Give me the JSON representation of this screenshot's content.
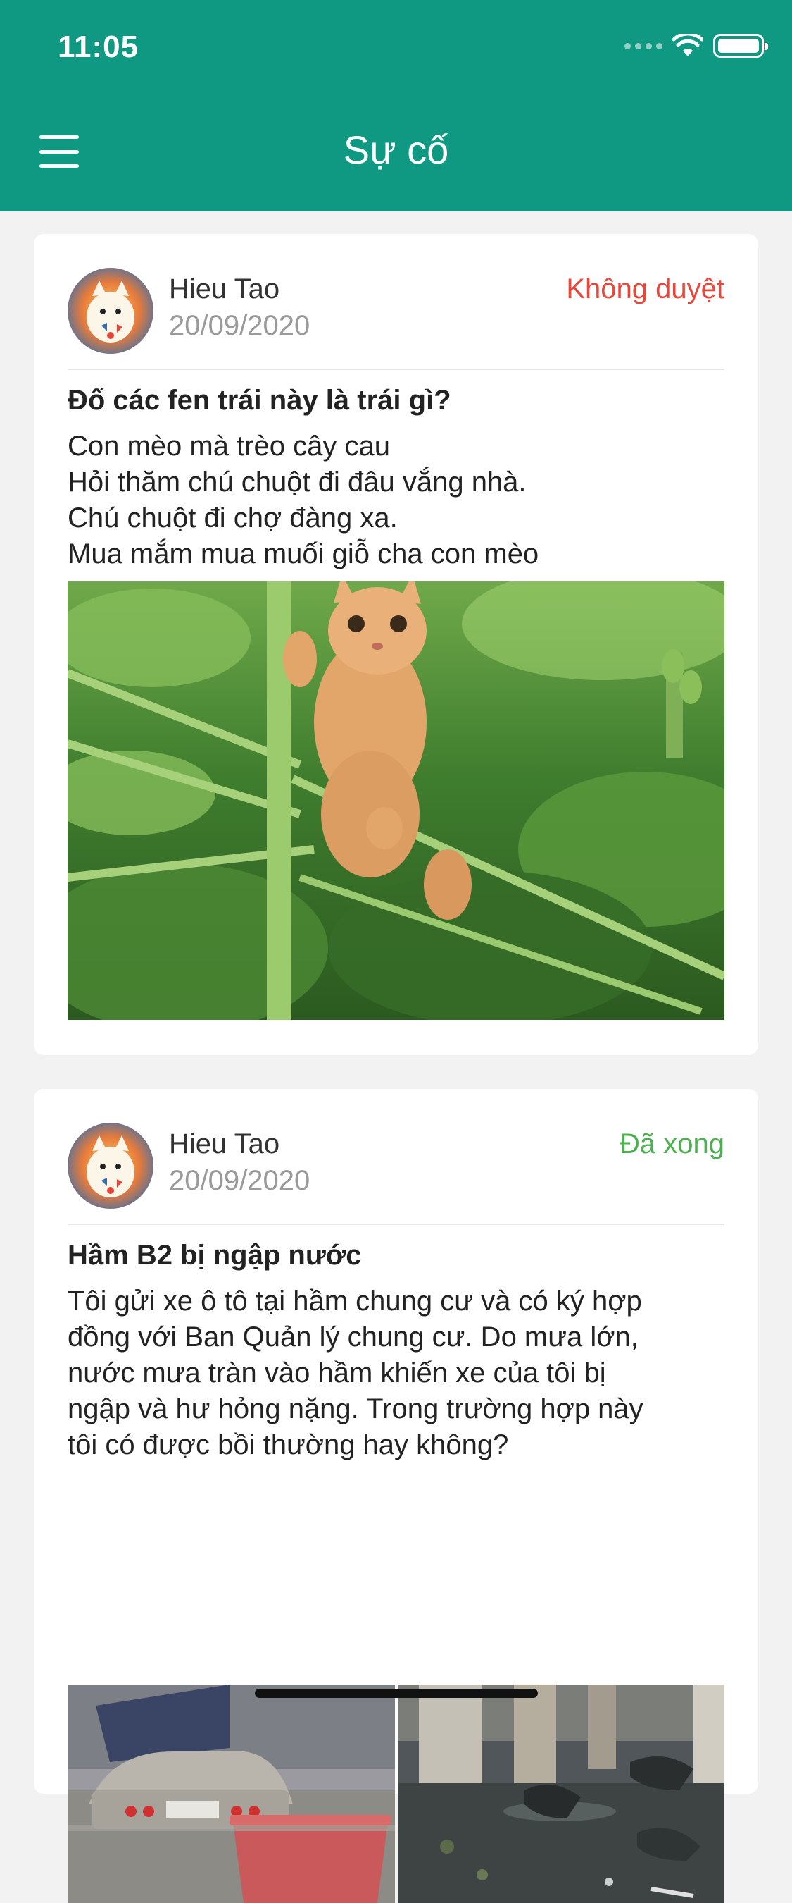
{
  "status_bar": {
    "time": "11:05"
  },
  "header": {
    "title": "Sự cố"
  },
  "colors": {
    "brand": "#0f9982",
    "status_rejected": "#e8473b",
    "status_done": "#4caf50"
  },
  "posts": [
    {
      "author": "Hieu Tao",
      "date": "20/09/2020",
      "status": "Không duyệt",
      "title": "Đố các fen trái này là trái gì?",
      "body_lines": [
        "Con mèo mà trèo cây cau",
        "Hỏi thăm chú chuột đi đâu vắng nhà.",
        "Chú chuột đi chợ đàng xa.",
        "Mua mắm mua muối giỗ cha con mèo"
      ]
    },
    {
      "author": "Hieu Tao",
      "date": "20/09/2020",
      "status": "Đã xong",
      "title": "Hầm B2 bị ngập nước",
      "body_lines": [
        "Tôi gửi xe ô tô tại hầm chung cư và có ký hợp",
        "đồng với Ban Quản lý chung cư. Do mưa lớn,",
        "nước mưa tràn vào hầm khiến xe của tôi bị",
        "ngập và hư hỏng nặng. Trong trường hợp này",
        "tôi có được bồi thường hay không?"
      ]
    }
  ]
}
